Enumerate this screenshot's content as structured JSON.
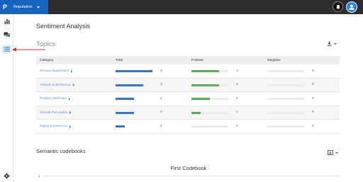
{
  "app": {
    "logo_letter": "P",
    "product_name": "Reputation"
  },
  "page": {
    "title": "Sentiment Analysis"
  },
  "topics": {
    "title": "Topics",
    "columns": {
      "category": "Category",
      "total": "Total",
      "positive": "Positive",
      "negative": "Negative"
    },
    "max_count": 4,
    "colors": {
      "total": "#3a72c8",
      "positive": "#5cab58",
      "negative": "#e53935"
    },
    "rows": [
      {
        "category": "Service Experience",
        "total": 4,
        "positive": 3,
        "negative": 0
      },
      {
        "category": "Attitude & Behaviour",
        "total": 3,
        "positive": 3,
        "negative": 0
      },
      {
        "category": "Product Attributes",
        "total": 2,
        "positive": 2,
        "negative": 0
      },
      {
        "category": "Overall Perception",
        "total": 2,
        "positive": 1,
        "negative": 0
      },
      {
        "category": "Digital Experience",
        "total": 1,
        "positive": 0,
        "negative": 0
      }
    ]
  },
  "codebooks": {
    "title": "Semantic codebooks",
    "chart_title": "First Codebook",
    "y_top_tick": "4"
  },
  "icons": {
    "bell": "bell-icon",
    "avatar": "user-icon",
    "nav_reports": "bar-chart-icon",
    "nav_reviews": "chat-bubbles-icon",
    "nav_topics": "list-icon",
    "settings": "gear-icon",
    "download": "download-icon",
    "codebook_chart": "chart-type-icon"
  }
}
